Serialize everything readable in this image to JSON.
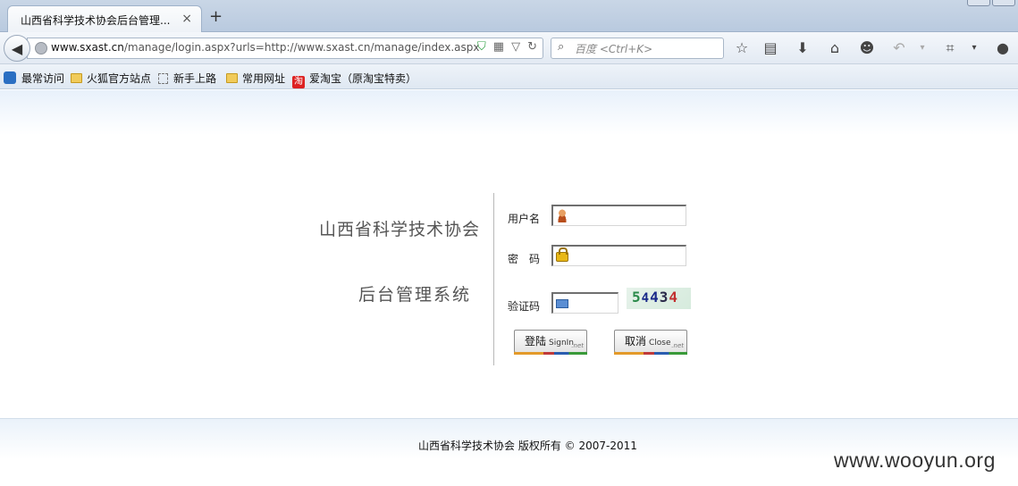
{
  "browser": {
    "tab_title": "山西省科学技术协会后台管理...",
    "tab_close": "×",
    "new_tab": "+",
    "url_host": "www.sxast.cn",
    "url_path": "/manage/login.aspx?urls=http://www.sxast.cn/manage/index.aspx",
    "search_placeholder": "百度 <Ctrl+K>",
    "bookmarks": [
      "最常访问",
      "火狐官方站点",
      "新手上路",
      "常用网址",
      "爱淘宝（原淘宝特卖）"
    ],
    "taobao_glyph": "淘"
  },
  "login": {
    "org_name": "山西省科学技术协会",
    "system_name": "后台管理系统",
    "username_label": "用户名",
    "password_label": "密　码",
    "captcha_label": "验证码",
    "captcha_digits": [
      "5",
      "4",
      "4",
      "3",
      "4"
    ],
    "signin_cn": "登陆",
    "signin_en": "SignIn",
    "close_cn": "取消",
    "close_en": "Close",
    "net_tag": ".net"
  },
  "footer": {
    "copyright": "山西省科学技术协会 版权所有 © 2007-2011"
  },
  "watermark": "www.wooyun.org"
}
